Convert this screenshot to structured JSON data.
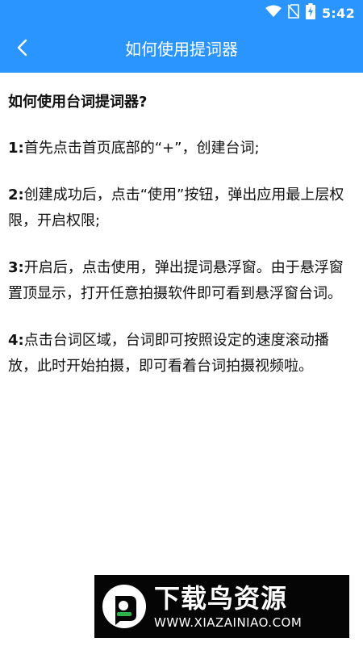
{
  "status_bar": {
    "time": "5:42",
    "icons": [
      "wifi-icon",
      "no-sim-icon",
      "battery-charging-icon"
    ]
  },
  "app_bar": {
    "title": "如何使用提词器",
    "back_icon": "chevron-left-icon"
  },
  "content": {
    "heading": "如何使用台词提词器?",
    "steps": [
      {
        "num": "1",
        "text": "首先点击首页底部的“+”，创建台词;"
      },
      {
        "num": "2",
        "text": "创建成功后，点击“使用”按钮，弹出应用最上层权限，开启权限;"
      },
      {
        "num": "3",
        "text": "开启后，点击使用，弹出提词悬浮窗。由于悬浮窗置顶显示，打开任意拍摄软件即可看到悬浮窗台词。"
      },
      {
        "num": "4",
        "text": "点击台词区域，台词即可按照设定的速度滚动播放，此时开始拍摄，即可看着台词拍摄视频啦。"
      }
    ],
    "separator": ":"
  },
  "watermark": {
    "brand": "下载鸟资源",
    "url": "WWW.XIAZAINIAO.COM"
  },
  "colors": {
    "primary": "#2a95ff",
    "text": "#111111",
    "watermark_bg": "#050505",
    "watermark_accent": "#2bb34a"
  }
}
